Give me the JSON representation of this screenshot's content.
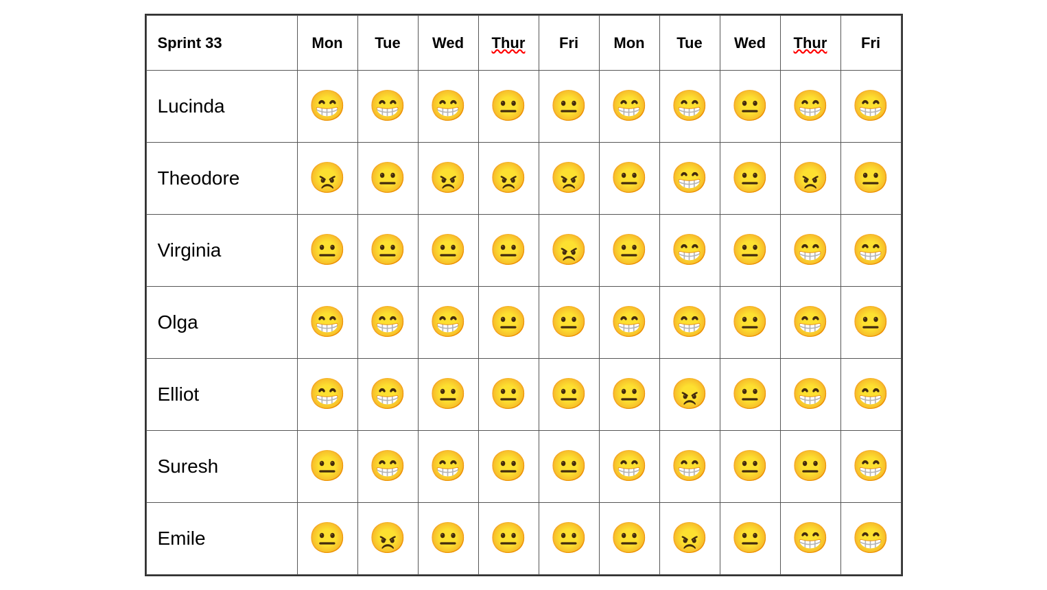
{
  "table": {
    "title": "Sprint 33",
    "columns": [
      {
        "label": "Mon",
        "underline": false
      },
      {
        "label": "Tue",
        "underline": false
      },
      {
        "label": "Wed",
        "underline": false
      },
      {
        "label": "Thur",
        "underline": true
      },
      {
        "label": "Fri",
        "underline": false
      },
      {
        "label": "Mon",
        "underline": false
      },
      {
        "label": "Tue",
        "underline": false
      },
      {
        "label": "Wed",
        "underline": false
      },
      {
        "label": "Thur",
        "underline": true
      },
      {
        "label": "Fri",
        "underline": false
      }
    ],
    "rows": [
      {
        "name": "Lucinda",
        "moods": [
          "happy",
          "happy",
          "happy",
          "neutral",
          "neutral",
          "happy",
          "happy",
          "neutral",
          "happy",
          "happy"
        ]
      },
      {
        "name": "Theodore",
        "moods": [
          "angry",
          "neutral",
          "angry",
          "angry",
          "angry",
          "neutral",
          "happy",
          "neutral",
          "angry",
          "neutral"
        ]
      },
      {
        "name": "Virginia",
        "moods": [
          "neutral",
          "neutral",
          "neutral",
          "neutral",
          "angry",
          "neutral",
          "happy",
          "neutral",
          "happy",
          "happy"
        ]
      },
      {
        "name": "Olga",
        "moods": [
          "happy",
          "happy",
          "happy",
          "neutral",
          "neutral",
          "happy",
          "happy",
          "neutral",
          "happy",
          "neutral"
        ]
      },
      {
        "name": "Elliot",
        "moods": [
          "happy",
          "happy",
          "neutral",
          "neutral",
          "neutral",
          "neutral",
          "angry",
          "neutral",
          "happy",
          "happy"
        ]
      },
      {
        "name": "Suresh",
        "moods": [
          "neutral",
          "happy",
          "happy",
          "neutral",
          "neutral",
          "happy",
          "happy",
          "neutral",
          "neutral",
          "happy"
        ]
      },
      {
        "name": "Emile",
        "moods": [
          "neutral",
          "angry",
          "neutral",
          "neutral",
          "neutral",
          "neutral",
          "angry",
          "neutral",
          "happy",
          "happy"
        ]
      }
    ]
  }
}
